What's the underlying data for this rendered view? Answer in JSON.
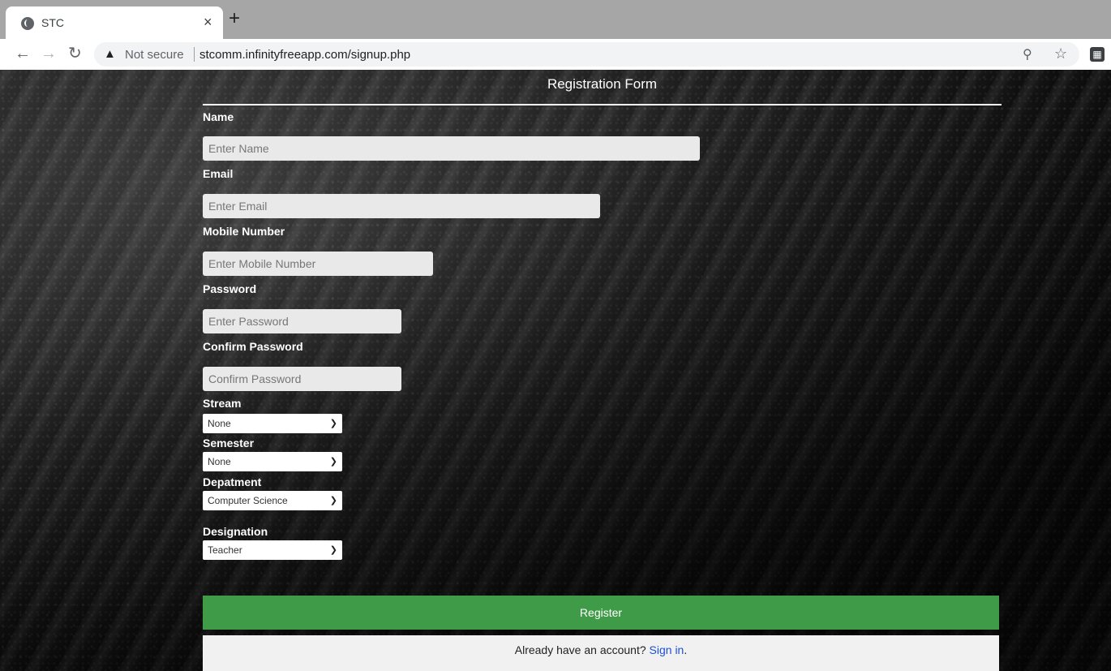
{
  "browser": {
    "tab_title": "STC",
    "close_glyph": "×",
    "new_tab_glyph": "+",
    "security_label": "Not secure",
    "url": "stcomm.infinityfreeapp.com/signup.php"
  },
  "form": {
    "title": "Registration Form",
    "fields": {
      "name": {
        "label": "Name",
        "placeholder": "Enter Name"
      },
      "email": {
        "label": "Email",
        "placeholder": "Enter Email"
      },
      "mobile": {
        "label": "Mobile Number",
        "placeholder": "Enter Mobile Number"
      },
      "password": {
        "label": "Password",
        "placeholder": "Enter Password"
      },
      "confirm": {
        "label": "Confirm Password",
        "placeholder": "Confirm Password"
      }
    },
    "selects": {
      "stream": {
        "label": "Stream",
        "value": "None"
      },
      "semester": {
        "label": "Semester",
        "value": "None"
      },
      "department": {
        "label": "Depatment",
        "value": "Computer Science"
      },
      "designation": {
        "label": "Designation",
        "value": "Teacher"
      }
    },
    "register_label": "Register",
    "signin_prompt": "Already have an account? ",
    "signin_link": "Sign in",
    "signin_suffix": "."
  },
  "colors": {
    "register_bg": "#409b48",
    "link": "#1f4fd6",
    "input_bg": "#e9e9e9"
  }
}
